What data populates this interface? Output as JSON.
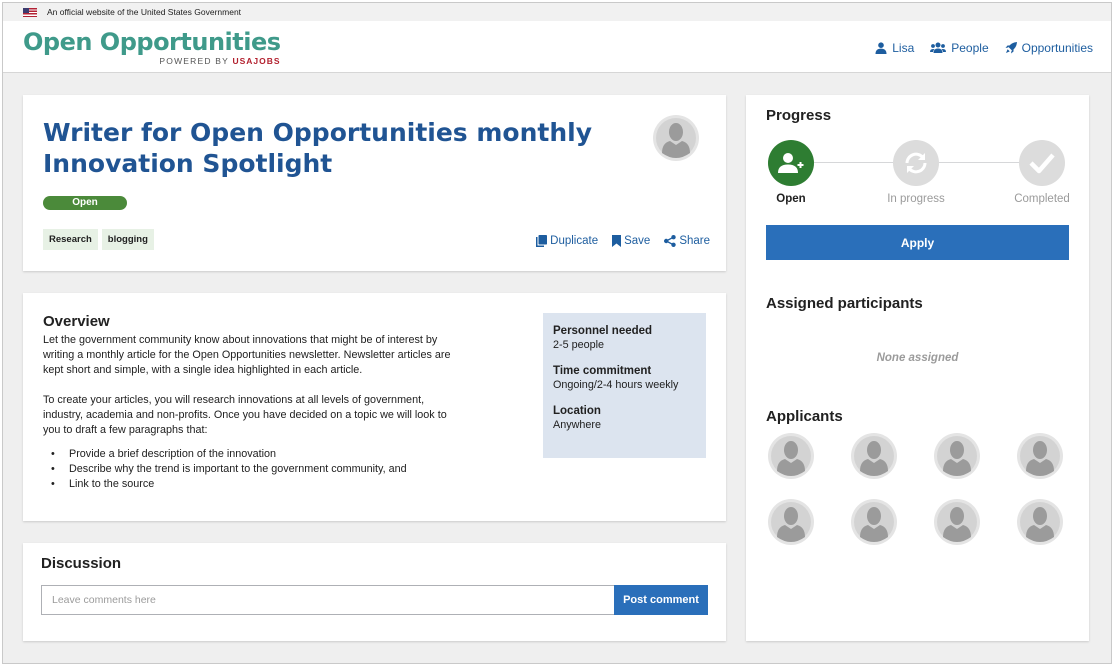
{
  "banner": {
    "text": "An official website of the United States Government"
  },
  "brand": {
    "title": "Open Opportunities",
    "powered_by": "POWERED BY",
    "powered_brand": "USAJOBS"
  },
  "nav": [
    {
      "label": "Lisa",
      "icon": "user-icon"
    },
    {
      "label": "People",
      "icon": "people-icon"
    },
    {
      "label": "Opportunities",
      "icon": "rocket-icon"
    }
  ],
  "opportunity": {
    "title": "Writer for Open Opportunities monthly Innovation Spotlight",
    "status": "Open",
    "tags": [
      "Research",
      "blogging"
    ],
    "actions": {
      "duplicate": "Duplicate",
      "save": "Save",
      "share": "Share"
    }
  },
  "overview": {
    "heading": "Overview",
    "paragraphs": [
      "Let the government community know about innovations that might be of interest by writing a monthly article for the Open Opportunities newsletter. Newsletter articles are kept short and simple, with a single idea highlighted in each article.",
      "To create your articles, you will research innovations at all levels of government, industry, academia and non-profits. Once you have decided on a topic we will look to you to draft a few paragraphs that:"
    ],
    "bullets": [
      "Provide a brief description of the innovation",
      "Describe why the trend is important to the government community, and",
      "Link to the source"
    ],
    "details": {
      "personnel_label": "Personnel needed",
      "personnel_value": "2-5 people",
      "time_label": "Time commitment",
      "time_value": "Ongoing/2-4 hours weekly",
      "location_label": "Location",
      "location_value": "Anywhere"
    }
  },
  "discussion": {
    "heading": "Discussion",
    "placeholder": "Leave comments here",
    "post_label": "Post comment"
  },
  "progress": {
    "heading": "Progress",
    "steps": [
      {
        "label": "Open",
        "state": "active"
      },
      {
        "label": "In progress",
        "state": "inactive"
      },
      {
        "label": "Completed",
        "state": "inactive"
      }
    ],
    "apply_label": "Apply"
  },
  "assigned": {
    "heading": "Assigned participants",
    "empty_text": "None assigned"
  },
  "applicants": {
    "heading": "Applicants",
    "count": 8
  },
  "colors": {
    "brand": "#3f9a8a",
    "title": "#205493",
    "link": "#1d5d9f",
    "primary": "#2a6fba",
    "active_step": "#2e7d32",
    "status_open": "#4b8a3a",
    "details_bg": "#dce4ef",
    "tag_bg": "#e7f1e5"
  }
}
